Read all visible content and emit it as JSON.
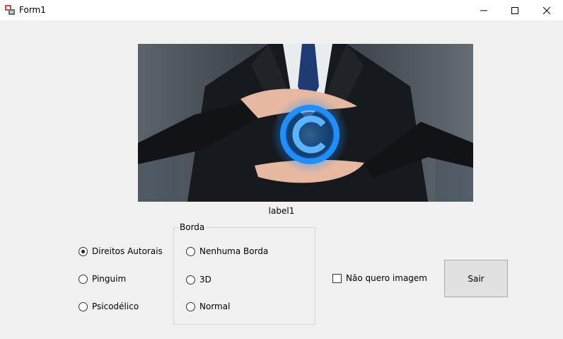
{
  "window": {
    "title": "Form1",
    "app_icon": "winforms-form-icon",
    "controls": [
      "minimize-icon",
      "maximize-icon",
      "close-icon"
    ]
  },
  "picture": {
    "description_icon": "copyright-icon",
    "accent": "#1e8fff"
  },
  "label1": "label1",
  "image_options": [
    {
      "label": "Direitos Autorais",
      "checked": true
    },
    {
      "label": "Pinguim",
      "checked": false
    },
    {
      "label": "Psicodélico",
      "checked": false
    }
  ],
  "borda_group": {
    "title": "Borda",
    "options": [
      {
        "label": "Nenhuma Borda",
        "checked": false
      },
      {
        "label": "3D",
        "checked": false
      },
      {
        "label": "Normal",
        "checked": false
      }
    ]
  },
  "checkbox": {
    "label": "Não quero imagem",
    "checked": false
  },
  "button_sair": "Sair"
}
